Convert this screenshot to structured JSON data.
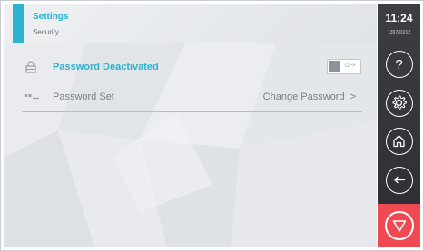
{
  "header": {
    "title": "Settings",
    "subtitle": "Security"
  },
  "rows": [
    {
      "label": "Password Deactivated",
      "icon": "lock-icon",
      "toggle": {
        "state": "OFF",
        "on": false
      }
    },
    {
      "label": "Password Set",
      "icon": "password-dots-icon",
      "action_label": "Change Password",
      "action_chevron": ">"
    }
  ],
  "sidebar": {
    "time": "11:24",
    "date": "1397/10/12",
    "buttons": [
      {
        "icon": "help-icon",
        "glyph": "?"
      },
      {
        "icon": "gear-icon"
      },
      {
        "icon": "home-icon"
      },
      {
        "icon": "back-arrow-icon"
      },
      {
        "icon": "stop-icon"
      }
    ]
  },
  "colors": {
    "accent": "#2bb3cf",
    "sidebar": "#333539",
    "stop": "#ef4a52"
  }
}
